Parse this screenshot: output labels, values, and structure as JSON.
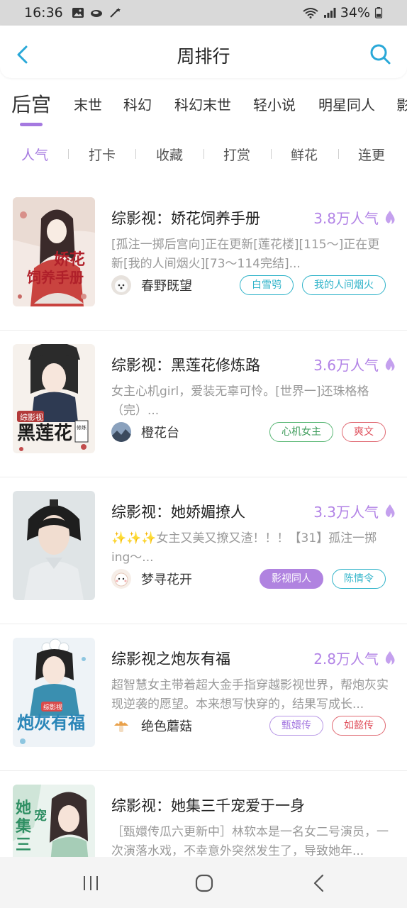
{
  "status_bar": {
    "time": "16:36",
    "battery": "34%",
    "icons": [
      "gallery-icon",
      "cloud-icon",
      "wand-icon",
      "wifi-icon",
      "signal-icon",
      "battery-icon"
    ]
  },
  "header": {
    "title": "周排行",
    "back_icon": "chevron-left-icon",
    "search_icon": "search-icon",
    "accent_color": "#29a8d8"
  },
  "category_tabs": [
    {
      "label": "后宫",
      "active": true
    },
    {
      "label": "末世"
    },
    {
      "label": "科幻"
    },
    {
      "label": "科幻末世"
    },
    {
      "label": "轻小说"
    },
    {
      "label": "明星同人"
    },
    {
      "label": "影"
    }
  ],
  "sort_tabs": [
    {
      "label": "人气",
      "active": true
    },
    {
      "label": "打卡"
    },
    {
      "label": "收藏"
    },
    {
      "label": "打赏"
    },
    {
      "label": "鲜花"
    },
    {
      "label": "连更"
    }
  ],
  "accent_purple": "#a579e0",
  "books": [
    {
      "title": "综影视：娇花饲养手册",
      "heat": "3.8万人气",
      "desc": "[孤注一掷后宫向]正在更新[莲花楼][115～]正在更新[我的人间烟火][73～114完结]...",
      "author": "春野既望",
      "tags": [
        {
          "label": "白雪鸮",
          "style": "cyan"
        },
        {
          "label": "我的人间烟火",
          "style": "cyan"
        }
      ]
    },
    {
      "title": "综影视：黑莲花修炼路",
      "heat": "3.6万人气",
      "desc": "女主心机girl，爱装无辜可怜。[世界一]还珠格格（完）...",
      "author": "橙花台",
      "tags": [
        {
          "label": "心机女主",
          "style": "green"
        },
        {
          "label": "爽文",
          "style": "red"
        }
      ]
    },
    {
      "title": "综影视：她娇媚撩人",
      "heat": "3.3万人气",
      "desc": "✨✨✨女主又美又撩又渣！！！【31】孤注一掷ing～...",
      "author": "梦寻花开",
      "tags": [
        {
          "label": "影视同人",
          "style": "purple-fill"
        },
        {
          "label": "陈情令",
          "style": "cyan"
        }
      ]
    },
    {
      "title": "综影视之炮灰有福",
      "heat": "2.8万人气",
      "desc": "超智慧女主带着超大金手指穿越影视世界，帮炮灰实现逆袭的愿望。本来想写快穿的，结果写成长...",
      "author": "绝色蘑菇",
      "tags": [
        {
          "label": "甄嬛传",
          "style": "purple"
        },
        {
          "label": "如懿传",
          "style": "red"
        }
      ]
    },
    {
      "title": "综影视：她集三千宠爱于一身",
      "heat": "",
      "desc": "［甄嬛传瓜六更新中］林软本是一名女二号演员，一次演落水戏，不幸意外突然发生了，导致她年...",
      "author": "",
      "tags": []
    }
  ],
  "nav_bar": {
    "icons": [
      "recent-apps-icon",
      "home-icon",
      "back-icon"
    ]
  }
}
